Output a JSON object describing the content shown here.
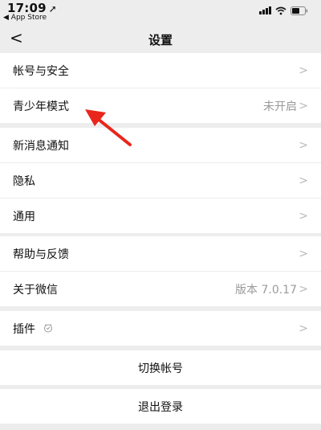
{
  "status_bar": {
    "time": "17:09",
    "back_app": "◀ App Store"
  },
  "nav": {
    "title": "设置",
    "back_glyph": "<"
  },
  "settings": {
    "account_security": "帐号与安全",
    "youth_mode": "青少年模式",
    "youth_mode_value": "未开启",
    "new_message_notify": "新消息通知",
    "privacy": "隐私",
    "general": "通用",
    "help_feedback": "帮助与反馈",
    "about_wechat": "关于微信",
    "version_value": "版本 7.0.17",
    "plugins": "插件",
    "switch_account": "切换帐号",
    "logout": "退出登录"
  },
  "chevron": ">",
  "colors": {
    "background": "#ededed",
    "row": "#ffffff",
    "secondary_text": "#9a9a9a",
    "arrow": "#e8261c"
  },
  "icons": {
    "location": "location-arrow-icon",
    "plugin": "plugin-icon"
  }
}
